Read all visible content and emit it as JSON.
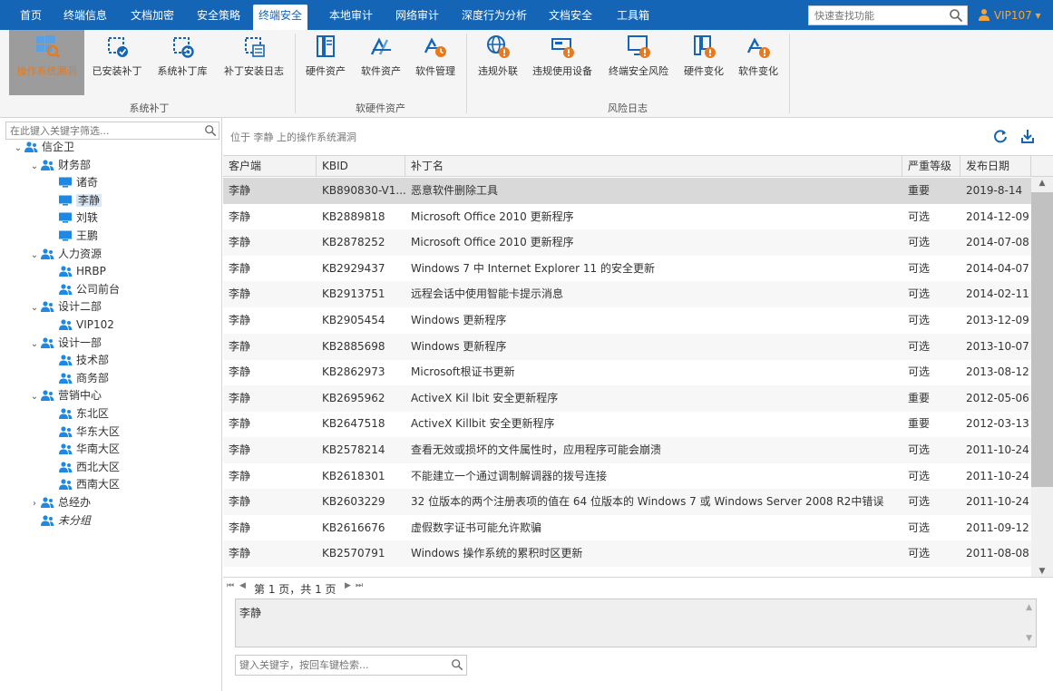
{
  "menu": {
    "tabs": [
      {
        "label": "首页"
      },
      {
        "label": "终端信息"
      },
      {
        "label": "文档加密"
      },
      {
        "label": "安全策略"
      },
      {
        "label": "终端安全"
      },
      {
        "label": "本地审计"
      },
      {
        "label": "网络审计"
      },
      {
        "label": "深度行为分析"
      },
      {
        "label": "文档安全"
      },
      {
        "label": "工具箱"
      }
    ],
    "active_tab": "终端安全",
    "search_placeholder": "快速查找功能",
    "user": "VIP107 ▾"
  },
  "ribbon": {
    "groups": [
      {
        "label": "系统补丁"
      },
      {
        "label": "软硬件资产"
      },
      {
        "label": "风险日志"
      }
    ],
    "buttons": [
      {
        "label": "操作系统漏洞",
        "icon": "windows-search-icon"
      },
      {
        "label": "已安装补丁",
        "icon": "chip-check-icon"
      },
      {
        "label": "系统补丁库",
        "icon": "chip-gear-icon"
      },
      {
        "label": "补丁安装日志",
        "icon": "chip-list-icon"
      },
      {
        "label": "硬件资产",
        "icon": "server-icon"
      },
      {
        "label": "软件资产",
        "icon": "apps-icon"
      },
      {
        "label": "软件管理",
        "icon": "apps-clock-icon"
      },
      {
        "label": "违规外联",
        "icon": "globe-warning-icon"
      },
      {
        "label": "违规使用设备",
        "icon": "device-warning-icon"
      },
      {
        "label": "终端安全风险",
        "icon": "monitor-warning-icon"
      },
      {
        "label": "硬件变化",
        "icon": "server-warning-icon"
      },
      {
        "label": "软件变化",
        "icon": "apps-warning-icon"
      }
    ]
  },
  "tree": {
    "filter_placeholder": "在此键入关键字筛选...",
    "nodes": [
      {
        "label": "信企卫"
      },
      {
        "label": "财务部"
      },
      {
        "label": "诸奇"
      },
      {
        "label": "李静"
      },
      {
        "label": "刘轶"
      },
      {
        "label": "王鹏"
      },
      {
        "label": "人力资源"
      },
      {
        "label": "HRBP"
      },
      {
        "label": "公司前台"
      },
      {
        "label": "设计二部"
      },
      {
        "label": "VIP102"
      },
      {
        "label": "设计一部"
      },
      {
        "label": "技术部"
      },
      {
        "label": "商务部"
      },
      {
        "label": "营销中心"
      },
      {
        "label": "东北区"
      },
      {
        "label": "华东大区"
      },
      {
        "label": "华南大区"
      },
      {
        "label": "西北大区"
      },
      {
        "label": "西南大区"
      },
      {
        "label": "总经办"
      },
      {
        "label": "未分组"
      }
    ]
  },
  "location_text": "位于 李静 上的操作系统漏洞",
  "grid": {
    "columns": [
      "客户端",
      "KBID",
      "补丁名",
      "严重等级",
      "发布日期"
    ],
    "rows": [
      [
        "李静",
        "KB890830-V1...",
        "恶意软件删除工具",
        "重要",
        "2019-8-14"
      ],
      [
        "李静",
        "KB2889818",
        "Microsoft Office 2010 更新程序",
        "可选",
        "2014-12-09"
      ],
      [
        "李静",
        "KB2878252",
        "Microsoft Office 2010 更新程序",
        "可选",
        "2014-07-08"
      ],
      [
        "李静",
        "KB2929437",
        "Windows 7 中 Internet Explorer 11 的安全更新",
        "可选",
        "2014-04-07"
      ],
      [
        "李静",
        "KB2913751",
        "远程会话中使用智能卡提示消息",
        "可选",
        "2014-02-11"
      ],
      [
        "李静",
        "KB2905454",
        "Windows 更新程序",
        "可选",
        "2013-12-09"
      ],
      [
        "李静",
        "KB2885698",
        "Windows 更新程序",
        "可选",
        "2013-10-07"
      ],
      [
        "李静",
        "KB2862973",
        "Microsoft根证书更新",
        "可选",
        "2013-08-12"
      ],
      [
        "李静",
        "KB2695962",
        "ActiveX Kil lbit 安全更新程序",
        "重要",
        "2012-05-06"
      ],
      [
        "李静",
        "KB2647518",
        "ActiveX Killbit 安全更新程序",
        "重要",
        "2012-03-13"
      ],
      [
        "李静",
        "KB2578214",
        "查看无效或损坏的文件属性时，应用程序可能会崩溃",
        "可选",
        "2011-10-24"
      ],
      [
        "李静",
        "KB2618301",
        "不能建立一个通过调制解调器的拨号连接",
        "可选",
        "2011-10-24"
      ],
      [
        "李静",
        "KB2603229",
        "32 位版本的两个注册表项的值在 64 位版本的 Windows 7 或 Windows Server 2008 R2中错误",
        "可选",
        "2011-10-24"
      ],
      [
        "李静",
        "KB2616676",
        "虚假数字证书可能允许欺骗",
        "可选",
        "2011-09-12"
      ],
      [
        "李静",
        "KB2570791",
        "Windows 操作系统的累积时区更新",
        "可选",
        "2011-08-08"
      ]
    ]
  },
  "pager_text": "第 1 页，共 1 页",
  "detail_text": "李静",
  "keyword_placeholder": "键入关键字，按回车键检索...",
  "colors": {
    "accent": "#1565b7",
    "active": "#e8791d",
    "user": "#f7a23a"
  }
}
